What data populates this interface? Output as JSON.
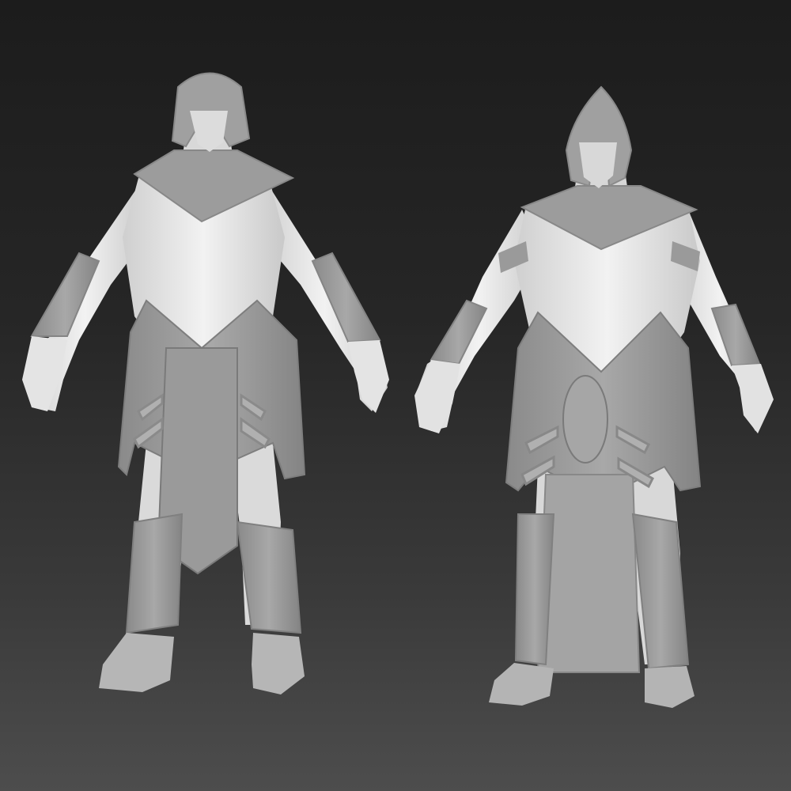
{
  "scene": {
    "kind": "3d-sculpt-render",
    "figures": [
      {
        "id": "armored-figure-left",
        "helmet": "rounded-helmet-icon"
      },
      {
        "id": "armored-figure-right",
        "helmet": "pointed-helmet-icon"
      }
    ],
    "colors": {
      "background_top": "#1c1c1c",
      "background_bottom": "#4d4d4d",
      "armor": "#9e9e9e",
      "armor_shade": "#7f7f7f",
      "skin": "#e8e8e8",
      "skin_shade": "#cfcfcf"
    }
  }
}
